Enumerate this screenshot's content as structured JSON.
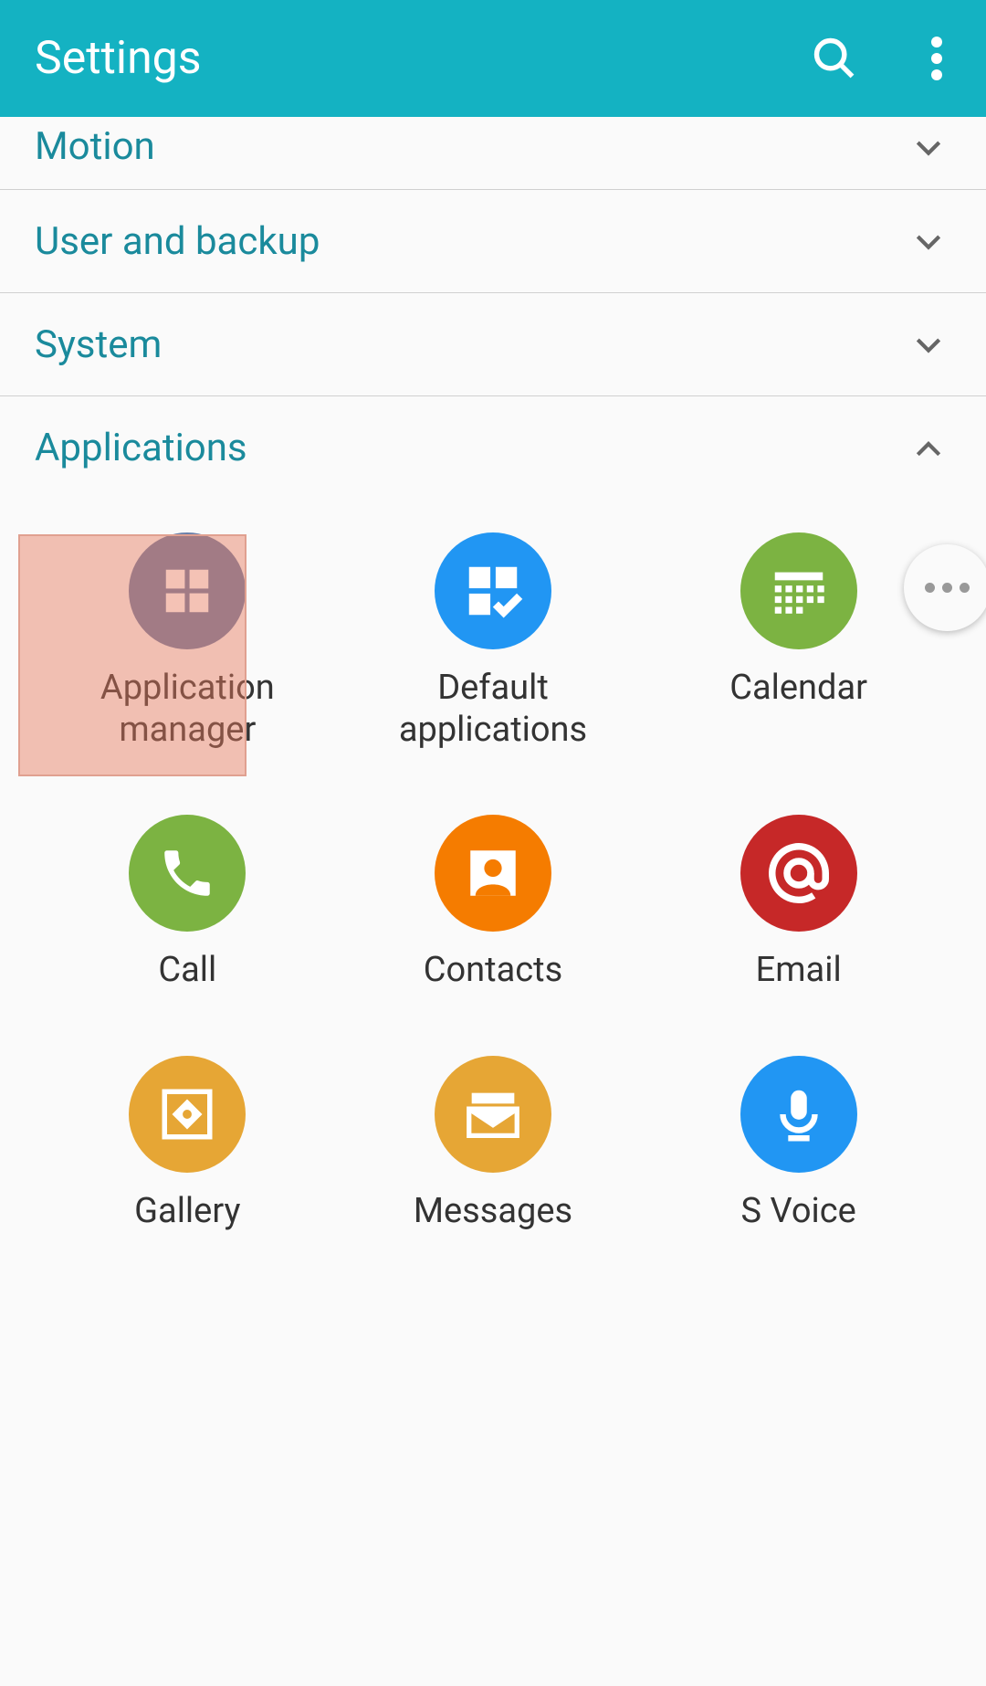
{
  "header": {
    "title": "Settings"
  },
  "categories": [
    {
      "label": "Motion"
    },
    {
      "label": "User and backup"
    },
    {
      "label": "System"
    }
  ],
  "expanded": {
    "label": "Applications",
    "items": [
      {
        "label": "Application manager",
        "icon": "grid-icon",
        "color": "darkblue"
      },
      {
        "label": "Default applications",
        "icon": "grid-check-icon",
        "color": "blue"
      },
      {
        "label": "Calendar",
        "icon": "calendar-icon",
        "color": "green"
      },
      {
        "label": "Call",
        "icon": "phone-icon",
        "color": "green"
      },
      {
        "label": "Contacts",
        "icon": "contact-icon",
        "color": "orange"
      },
      {
        "label": "Email",
        "icon": "at-icon",
        "color": "red"
      },
      {
        "label": "Gallery",
        "icon": "gallery-icon",
        "color": "mustard"
      },
      {
        "label": "Messages",
        "icon": "envelope-icon",
        "color": "mustard"
      },
      {
        "label": "S Voice",
        "icon": "mic-icon",
        "color": "skyblue"
      }
    ]
  }
}
